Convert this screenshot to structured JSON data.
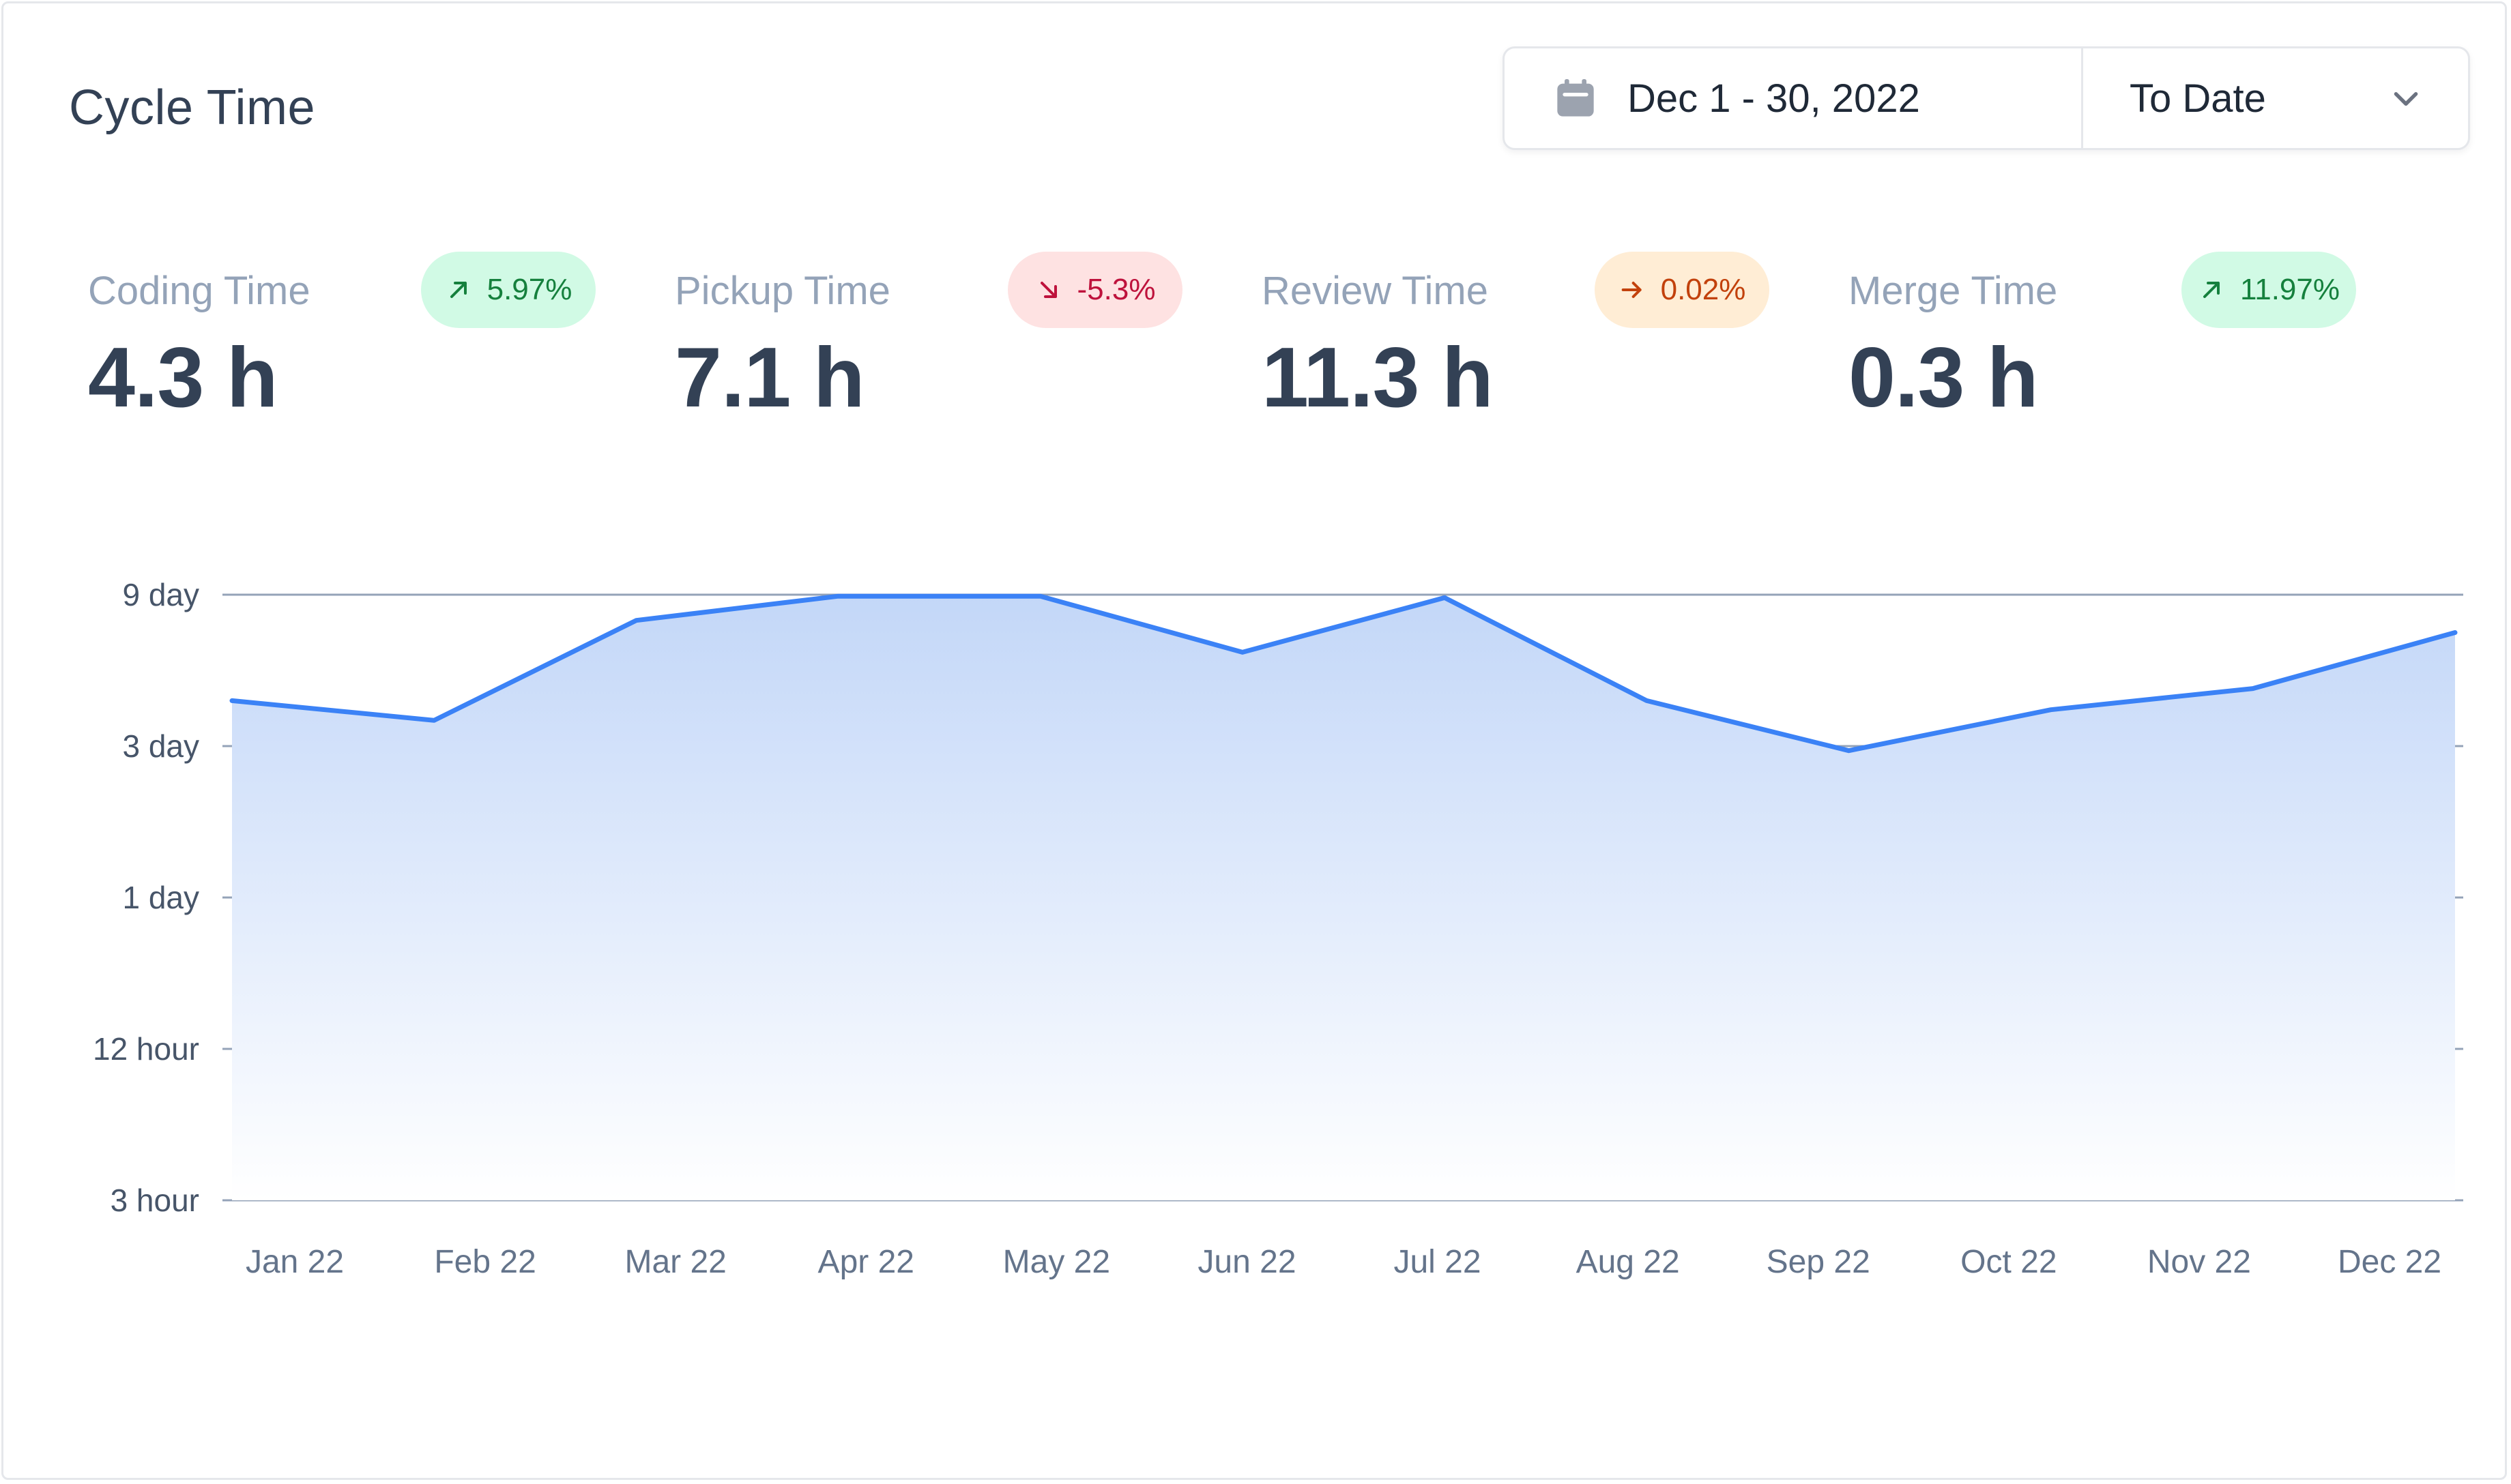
{
  "card": {
    "title": "Cycle Time"
  },
  "date_picker": {
    "range_label": "Dec 1 - 30, 2022",
    "period_label": "To Date"
  },
  "metrics": [
    {
      "label": "Coding Time",
      "value": "4.3 h",
      "change": "5.97%",
      "trend": "up"
    },
    {
      "label": "Pickup Time",
      "value": "7.1 h",
      "change": "-5.3%",
      "trend": "down"
    },
    {
      "label": "Review Time",
      "value": "11.3 h",
      "change": "0.02%",
      "trend": "flat"
    },
    {
      "label": "Merge Time",
      "value": "0.3 h",
      "change": "11.97%",
      "trend": "up"
    }
  ],
  "colors": {
    "line": "#3b82f6",
    "area_top": "#c3d7f8",
    "grid": "#94a3b8",
    "badge_up": "#d1fae5",
    "badge_down": "#fee2e2",
    "badge_flat": "#ffedd5"
  },
  "chart_data": {
    "type": "area",
    "categories": [
      "Jan 22",
      "Feb 22",
      "Mar 22",
      "Apr 22",
      "May 22",
      "Jun 22",
      "Jul 22",
      "Aug 22",
      "Sep 22",
      "Oct 22",
      "Nov 22",
      "Dec 22"
    ],
    "y_ticks": [
      "3 hour",
      "12 hour",
      "1 day",
      "3 day",
      "9 day"
    ],
    "values_tick_position": [
      3.3,
      3.17,
      3.83,
      3.99,
      3.99,
      3.62,
      3.98,
      3.3,
      2.97,
      3.24,
      3.38,
      3.75
    ],
    "scale": "categorical-log",
    "grid": true,
    "title": "",
    "xlabel": "",
    "ylabel": ""
  }
}
